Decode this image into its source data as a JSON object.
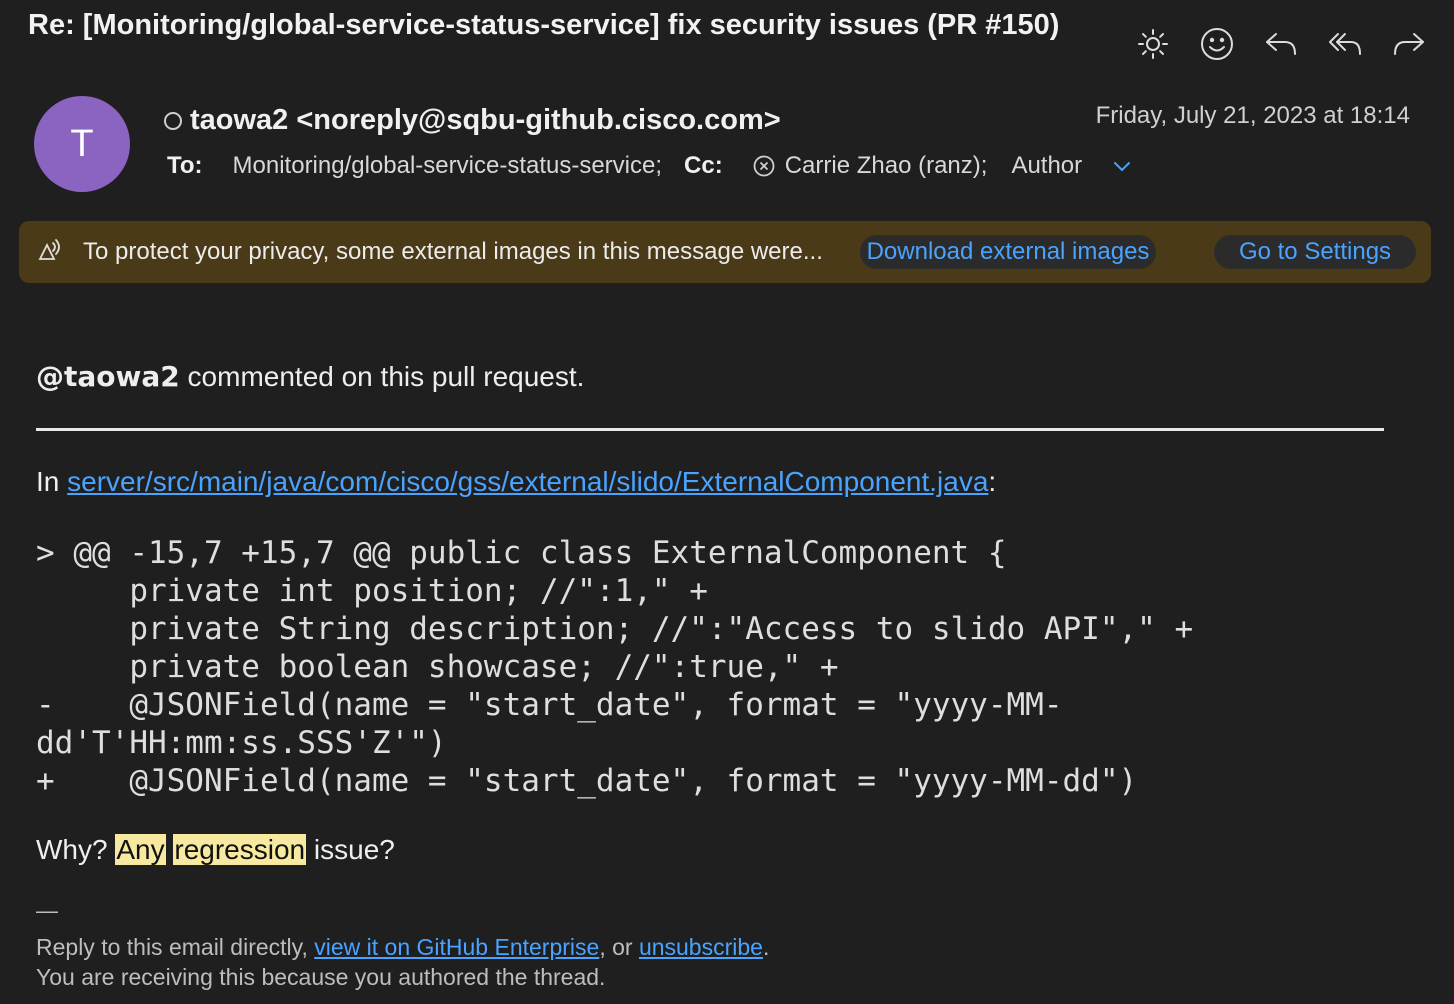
{
  "email": {
    "subject": "Re: [Monitoring/global-service-status-service] fix security issues (PR #150)",
    "avatar_initial": "T",
    "sender": "taowa2 <noreply@sqbu-github.cisco.com>",
    "date": "Friday, July 21, 2023 at 18:14",
    "to_label": "To:",
    "to_value": "Monitoring/global-service-status-service;",
    "cc_label": "Cc:",
    "cc_value": "Carrie Zhao (ranz);",
    "cc_extra": "Author"
  },
  "toolbar": {
    "icons": [
      "brightness-icon",
      "emoji-icon",
      "reply-icon",
      "reply-all-icon",
      "forward-icon"
    ]
  },
  "banner": {
    "text": "To protect your privacy, some external images in this message were...",
    "download_label": "Download external images",
    "settings_label": "Go to Settings",
    "bg_color": "#4a3a17",
    "link_color": "#4aa3ff"
  },
  "body": {
    "comment_user": "@taowa2",
    "comment_text": " commented on this pull request.",
    "file_prefix": "In ",
    "file_link": "server/src/main/java/com/cisco/gss/external/slido/ExternalComponent.java",
    "file_suffix": ":",
    "code": "> @@ -15,7 +15,7 @@ public class ExternalComponent {\n     private int position; //\":1,\" +\n     private String description; //\":\"Access to slido API\",\" +\n     private boolean showcase; //\":true,\" +\n-    @JSONField(name = \"start_date\", format = \"yyyy-MM-\ndd'T'HH:mm:ss.SSS'Z'\")\n+    @JSONField(name = \"start_date\", format = \"yyyy-MM-dd\")",
    "question_prefix": "Why? ",
    "question_hl1": "Any",
    "question_hl2": "regression",
    "question_suffix": " issue?",
    "highlight_color": "#f7e9a0"
  },
  "footer": {
    "dash": "—",
    "reply_prefix": "Reply to this email directly, ",
    "view_link": "view it on GitHub Enterprise",
    "or_text": ", or ",
    "unsubscribe_link": "unsubscribe",
    "period": ".",
    "reason": "You are receiving this because you authored the thread."
  }
}
